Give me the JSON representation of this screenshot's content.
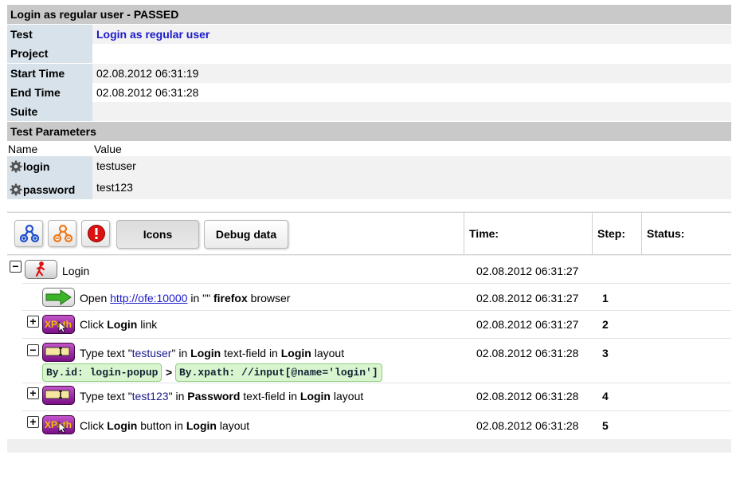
{
  "report": {
    "title": "Login as regular user - PASSED",
    "fields": {
      "test_label": "Test",
      "test_value": "Login as regular user",
      "project_label": "Project",
      "project_value": "",
      "start_label": "Start Time",
      "start_value": "02.08.2012 06:31:19",
      "end_label": "End Time",
      "end_value": "02.08.2012 06:31:28",
      "suite_label": "Suite",
      "suite_value": ""
    },
    "params_title": "Test Parameters",
    "params_headers": {
      "name": "Name",
      "value": "Value"
    },
    "params": [
      {
        "name": "login",
        "value": "testuser",
        "icon": "gear-icon"
      },
      {
        "name": "password",
        "value": "test123",
        "icon": "gear-icon"
      }
    ]
  },
  "toolbar": {
    "icons_label": "Icons",
    "debug_label": "Debug data",
    "col_time": "Time:",
    "col_step": "Step:",
    "col_status": "Status:"
  },
  "steps": [
    {
      "text_parts": [
        "Login"
      ],
      "time": "02.08.2012 06:31:27",
      "num": "",
      "icon": "walking-man-icon"
    },
    {
      "pre": "Open ",
      "link": "http://ofe:10000",
      "mid": " in \"\" ",
      "bold": "firefox",
      "post": " browser",
      "time": "02.08.2012 06:31:27",
      "num": "1",
      "icon": "arrow-right-icon"
    },
    {
      "pre": "Click ",
      "bold": "Login",
      "post": " link",
      "time": "02.08.2012 06:31:27",
      "num": "2",
      "icon": "xpath-click-icon"
    },
    {
      "pre": "Type text \"",
      "quoted": "testuser",
      "mid": "\" in ",
      "bold1": "Login",
      "mid2": " text-field in ",
      "bold2": "Login",
      "post": " layout",
      "time": "02.08.2012 06:31:28",
      "num": "3",
      "icon": "text-field-icon",
      "locators": [
        "By.id: login-popup",
        "By.xpath: //input[@name='login']"
      ],
      "locator_sep": ">"
    },
    {
      "pre": "Type text \"",
      "quoted": "test123",
      "mid": "\" in ",
      "bold1": "Password",
      "mid2": " text-field in ",
      "bold2": "Login",
      "post": " layout",
      "time": "02.08.2012 06:31:28",
      "num": "4",
      "icon": "text-field-icon"
    },
    {
      "pre": "Click ",
      "bold1": "Login",
      "mid": " button in ",
      "bold2": "Login",
      "post": " layout",
      "time": "02.08.2012 06:31:28",
      "num": "5",
      "icon": "xpath-click-icon"
    }
  ],
  "colors": {
    "header_bg": "#c9c9c9",
    "label_bg": "#d7e2ea",
    "value_bg": "#f2f2f2",
    "link": "#1a1acc"
  }
}
